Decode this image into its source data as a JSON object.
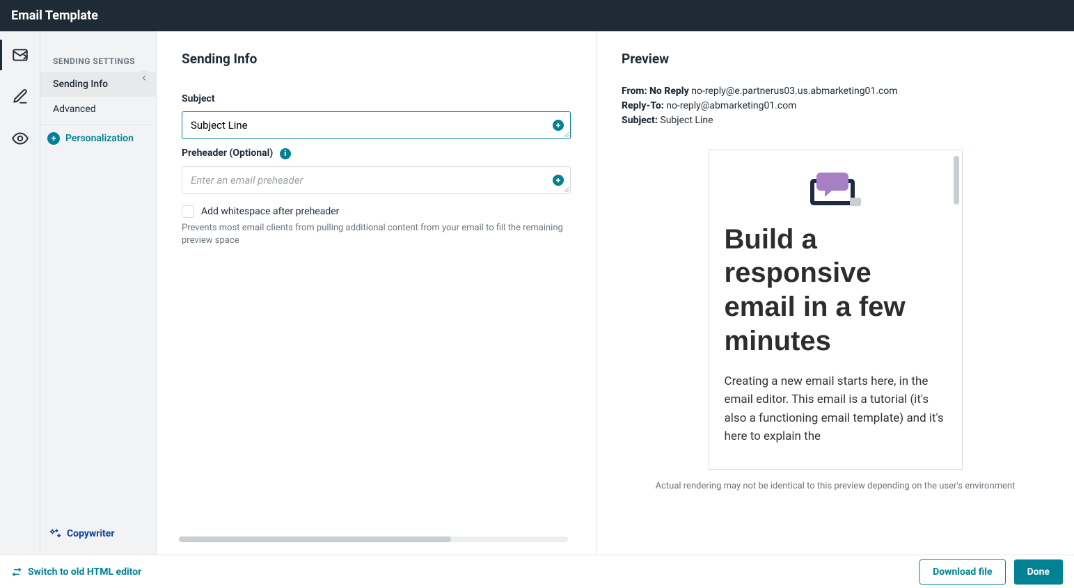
{
  "header": {
    "title": "Email Template"
  },
  "rail": {
    "items": [
      {
        "name": "send-icon",
        "active": true
      },
      {
        "name": "edit-icon",
        "active": false
      },
      {
        "name": "preview-icon",
        "active": false
      }
    ]
  },
  "sidebar": {
    "section_label": "Sending Settings",
    "items": [
      {
        "label": "Sending Info",
        "active": true
      },
      {
        "label": "Advanced",
        "active": false
      }
    ],
    "personalization_label": "Personalization",
    "copywriter_label": "Copywriter"
  },
  "form": {
    "heading": "Sending Info",
    "subject_label": "Subject",
    "subject_value": "Subject Line",
    "preheader_label": "Preheader (Optional)",
    "preheader_placeholder": "Enter an email preheader",
    "whitespace_label": "Add whitespace after preheader",
    "whitespace_hint": "Prevents most email clients from pulling additional content from your email to fill the remaining preview space"
  },
  "preview": {
    "heading": "Preview",
    "from_label": "From:",
    "from_name": "No Reply",
    "from_email": "no-reply@e.partnerus03.us.abmarketing01.com",
    "reply_to_label": "Reply-To:",
    "reply_to_email": "no-reply@abmarketing01.com",
    "subject_label": "Subject:",
    "subject_value": "Subject Line",
    "hero_title": "Build a responsive email in a few minutes",
    "body_text": "Creating a new email starts here, in the email editor. This email is a tutorial (it's also a functioning email template) and it's here to explain the",
    "disclaimer": "Actual rendering may not be identical to this preview depending on the user's environment"
  },
  "footer": {
    "switch_label": "Switch to old HTML editor",
    "download_label": "Download file",
    "done_label": "Done"
  }
}
